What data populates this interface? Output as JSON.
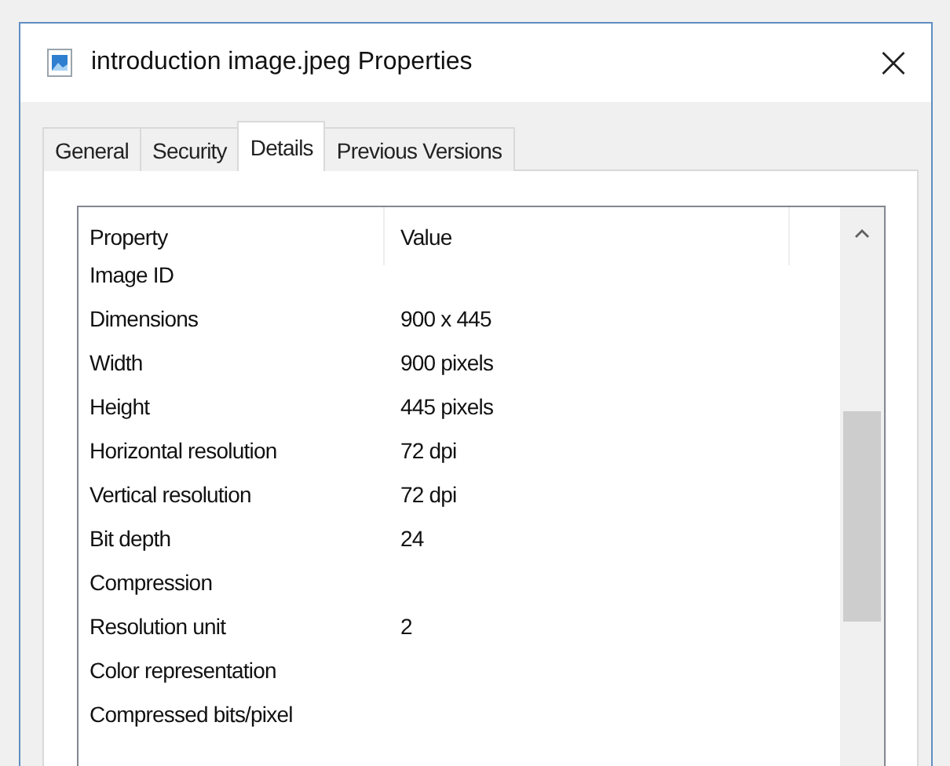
{
  "window": {
    "title": "introduction image.jpeg Properties",
    "close": "×"
  },
  "tabs": [
    {
      "label": "General",
      "selected": false
    },
    {
      "label": "Security",
      "selected": false
    },
    {
      "label": "Details",
      "selected": true
    },
    {
      "label": "Previous Versions",
      "selected": false
    }
  ],
  "table": {
    "columns": [
      "Property",
      "Value"
    ],
    "rows": [
      {
        "property": "Image ID",
        "value": ""
      },
      {
        "property": "Dimensions",
        "value": "900 x 445"
      },
      {
        "property": "Width",
        "value": "900 pixels"
      },
      {
        "property": "Height",
        "value": "445 pixels"
      },
      {
        "property": "Horizontal resolution",
        "value": "72 dpi"
      },
      {
        "property": "Vertical resolution",
        "value": "72 dpi"
      },
      {
        "property": "Bit depth",
        "value": "24"
      },
      {
        "property": "Compression",
        "value": ""
      },
      {
        "property": "Resolution unit",
        "value": "2"
      },
      {
        "property": "Color representation",
        "value": ""
      },
      {
        "property": "Compressed bits/pixel",
        "value": ""
      }
    ]
  }
}
